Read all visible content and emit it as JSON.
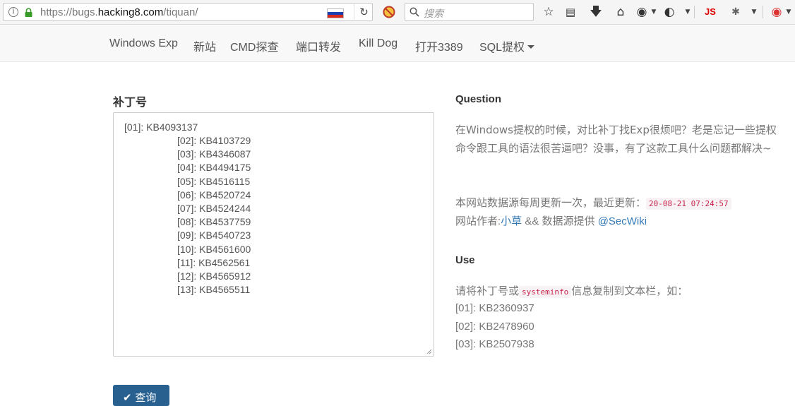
{
  "browser": {
    "url_prefix": "https://bugs.",
    "url_domain": "hacking8.com",
    "url_path": "/tiquan/",
    "search_placeholder": "搜索",
    "js_label": "JS"
  },
  "nav": {
    "items": [
      "Windows Exp",
      "新站",
      "CMD探查",
      "端口转发",
      "Kill Dog",
      "打开3389",
      "SQL提权"
    ]
  },
  "left": {
    "title": "补丁号",
    "kb_lines": [
      "[01]: KB4093137",
      "[02]: KB4103729",
      "[03]: KB4346087",
      "[04]: KB4494175",
      "[05]: KB4516115",
      "[06]: KB4520724",
      "[07]: KB4524244",
      "[08]: KB4537759",
      "[09]: KB4540723",
      "[10]: KB4561600",
      "[11]: KB4562561",
      "[12]: KB4565912",
      "[13]: KB4565511"
    ],
    "query_label": "查询"
  },
  "right": {
    "question_heading": "Question",
    "question_text": "在Windows提权的时候，对比补丁找Exp很烦吧？老是忘记一些提权命令跟工具的语法很苦逼吧？没事，有了这款工具什么问题都解决~",
    "update_prefix": "本网站数据源每周更新一次，最近更新：",
    "update_time": "20-08-21 07:24:57",
    "author_prefix": "网站作者:",
    "author_name": "小草",
    "author_mid": " && 数据源提供 ",
    "source_name": "@SecWiki",
    "use_heading": "Use",
    "use_prefix": "请将补丁号或",
    "use_code": "systeminfo",
    "use_suffix": "信息复制到文本栏，如：",
    "examples": [
      "[01]: KB2360937",
      "[02]: KB2478960",
      "[03]: KB2507938"
    ]
  }
}
